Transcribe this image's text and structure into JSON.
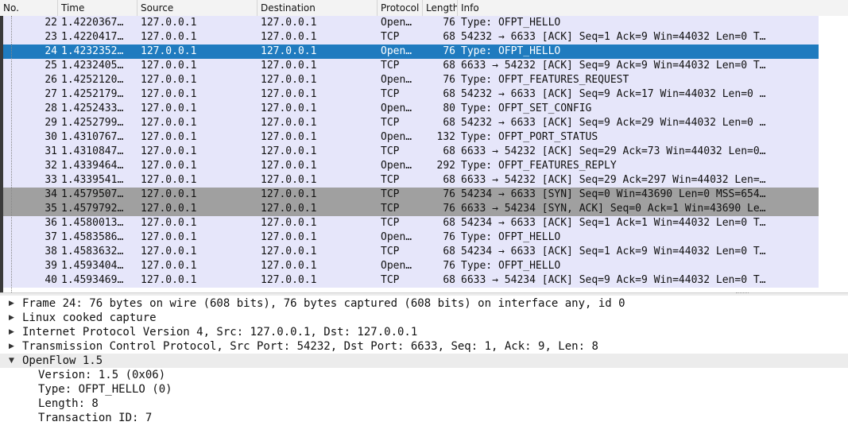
{
  "columns": {
    "no": "No.",
    "time": "Time",
    "source": "Source",
    "destination": "Destination",
    "protocol": "Protocol",
    "length": "Length",
    "info": "Info"
  },
  "packets": [
    {
      "no": "22",
      "time": "1.4220367…",
      "src": "127.0.0.1",
      "dst": "127.0.0.1",
      "proto": "Open…",
      "len": "76",
      "info": "Type: OFPT_HELLO",
      "style": "normal"
    },
    {
      "no": "23",
      "time": "1.4220417…",
      "src": "127.0.0.1",
      "dst": "127.0.0.1",
      "proto": "TCP",
      "len": "68",
      "info": "54232 → 6633 [ACK] Seq=1 Ack=9 Win=44032 Len=0 T…",
      "style": "normal"
    },
    {
      "no": "24",
      "time": "1.4232352…",
      "src": "127.0.0.1",
      "dst": "127.0.0.1",
      "proto": "Open…",
      "len": "76",
      "info": "Type: OFPT_HELLO",
      "style": "selected"
    },
    {
      "no": "25",
      "time": "1.4232405…",
      "src": "127.0.0.1",
      "dst": "127.0.0.1",
      "proto": "TCP",
      "len": "68",
      "info": "6633 → 54232 [ACK] Seq=9 Ack=9 Win=44032 Len=0 T…",
      "style": "normal"
    },
    {
      "no": "26",
      "time": "1.4252120…",
      "src": "127.0.0.1",
      "dst": "127.0.0.1",
      "proto": "Open…",
      "len": "76",
      "info": "Type: OFPT_FEATURES_REQUEST",
      "style": "normal"
    },
    {
      "no": "27",
      "time": "1.4252179…",
      "src": "127.0.0.1",
      "dst": "127.0.0.1",
      "proto": "TCP",
      "len": "68",
      "info": "54232 → 6633 [ACK] Seq=9 Ack=17 Win=44032 Len=0 …",
      "style": "normal"
    },
    {
      "no": "28",
      "time": "1.4252433…",
      "src": "127.0.0.1",
      "dst": "127.0.0.1",
      "proto": "Open…",
      "len": "80",
      "info": "Type: OFPT_SET_CONFIG",
      "style": "normal"
    },
    {
      "no": "29",
      "time": "1.4252799…",
      "src": "127.0.0.1",
      "dst": "127.0.0.1",
      "proto": "TCP",
      "len": "68",
      "info": "54232 → 6633 [ACK] Seq=9 Ack=29 Win=44032 Len=0 …",
      "style": "normal"
    },
    {
      "no": "30",
      "time": "1.4310767…",
      "src": "127.0.0.1",
      "dst": "127.0.0.1",
      "proto": "Open…",
      "len": "132",
      "info": "Type: OFPT_PORT_STATUS",
      "style": "normal"
    },
    {
      "no": "31",
      "time": "1.4310847…",
      "src": "127.0.0.1",
      "dst": "127.0.0.1",
      "proto": "TCP",
      "len": "68",
      "info": "6633 → 54232 [ACK] Seq=29 Ack=73 Win=44032 Len=0…",
      "style": "normal"
    },
    {
      "no": "32",
      "time": "1.4339464…",
      "src": "127.0.0.1",
      "dst": "127.0.0.1",
      "proto": "Open…",
      "len": "292",
      "info": "Type: OFPT_FEATURES_REPLY",
      "style": "normal"
    },
    {
      "no": "33",
      "time": "1.4339541…",
      "src": "127.0.0.1",
      "dst": "127.0.0.1",
      "proto": "TCP",
      "len": "68",
      "info": "6633 → 54232 [ACK] Seq=29 Ack=297 Win=44032 Len=…",
      "style": "normal"
    },
    {
      "no": "34",
      "time": "1.4579507…",
      "src": "127.0.0.1",
      "dst": "127.0.0.1",
      "proto": "TCP",
      "len": "76",
      "info": "54234 → 6633 [SYN] Seq=0 Win=43690 Len=0 MSS=654…",
      "style": "dark"
    },
    {
      "no": "35",
      "time": "1.4579792…",
      "src": "127.0.0.1",
      "dst": "127.0.0.1",
      "proto": "TCP",
      "len": "76",
      "info": "6633 → 54234 [SYN, ACK] Seq=0 Ack=1 Win=43690 Le…",
      "style": "dark"
    },
    {
      "no": "36",
      "time": "1.4580013…",
      "src": "127.0.0.1",
      "dst": "127.0.0.1",
      "proto": "TCP",
      "len": "68",
      "info": "54234 → 6633 [ACK] Seq=1 Ack=1 Win=44032 Len=0 T…",
      "style": "normal"
    },
    {
      "no": "37",
      "time": "1.4583586…",
      "src": "127.0.0.1",
      "dst": "127.0.0.1",
      "proto": "Open…",
      "len": "76",
      "info": "Type: OFPT_HELLO",
      "style": "normal"
    },
    {
      "no": "38",
      "time": "1.4583632…",
      "src": "127.0.0.1",
      "dst": "127.0.0.1",
      "proto": "TCP",
      "len": "68",
      "info": "54234 → 6633 [ACK] Seq=1 Ack=9 Win=44032 Len=0 T…",
      "style": "normal"
    },
    {
      "no": "39",
      "time": "1.4593404…",
      "src": "127.0.0.1",
      "dst": "127.0.0.1",
      "proto": "Open…",
      "len": "76",
      "info": "Type: OFPT_HELLO",
      "style": "normal"
    },
    {
      "no": "40",
      "time": "1.4593469…",
      "src": "127.0.0.1",
      "dst": "127.0.0.1",
      "proto": "TCP",
      "len": "68",
      "info": "6633 → 54234 [ACK] Seq=9 Ack=9 Win=44032 Len=0 T…",
      "style": "normal"
    }
  ],
  "details": [
    {
      "text": "Frame 24: 76 bytes on wire (608 bits), 76 bytes captured (608 bits) on interface any, id 0",
      "state": "collapsed",
      "indent": 0
    },
    {
      "text": "Linux cooked capture",
      "state": "collapsed",
      "indent": 0
    },
    {
      "text": "Internet Protocol Version 4, Src: 127.0.0.1, Dst: 127.0.0.1",
      "state": "collapsed",
      "indent": 0
    },
    {
      "text": "Transmission Control Protocol, Src Port: 54232, Dst Port: 6633, Seq: 1, Ack: 9, Len: 8",
      "state": "collapsed",
      "indent": 0
    },
    {
      "text": "OpenFlow 1.5",
      "state": "expanded",
      "indent": 0
    },
    {
      "text": "Version: 1.5 (0x06)",
      "state": "leaf",
      "indent": 1
    },
    {
      "text": "Type: OFPT_HELLO (0)",
      "state": "leaf",
      "indent": 1
    },
    {
      "text": "Length: 8",
      "state": "leaf",
      "indent": 1
    },
    {
      "text": "Transaction ID: 7",
      "state": "leaf",
      "indent": 1
    }
  ],
  "colors": {
    "row_normal": "#e6e6fa",
    "row_selected": "#1f7bbf",
    "row_dark": "#a0a0a0",
    "expanded_bg": "#ececec"
  }
}
